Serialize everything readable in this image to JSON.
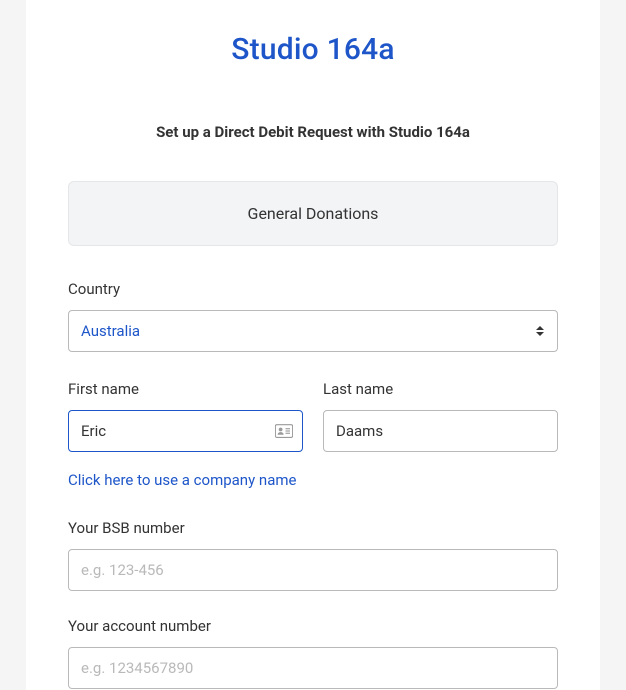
{
  "brand": {
    "title": "Studio 164a"
  },
  "heading": "Set up a Direct Debit Request with Studio 164a",
  "section_banner": "General Donations",
  "country": {
    "label": "Country",
    "selected": "Australia"
  },
  "first_name": {
    "label": "First name",
    "value": "Eric"
  },
  "last_name": {
    "label": "Last name",
    "value": "Daams"
  },
  "company_link": "Click here to use a company name",
  "bsb": {
    "label": "Your BSB number",
    "placeholder": "e.g. 123-456"
  },
  "account": {
    "label": "Your account number",
    "placeholder": "e.g. 1234567890"
  }
}
